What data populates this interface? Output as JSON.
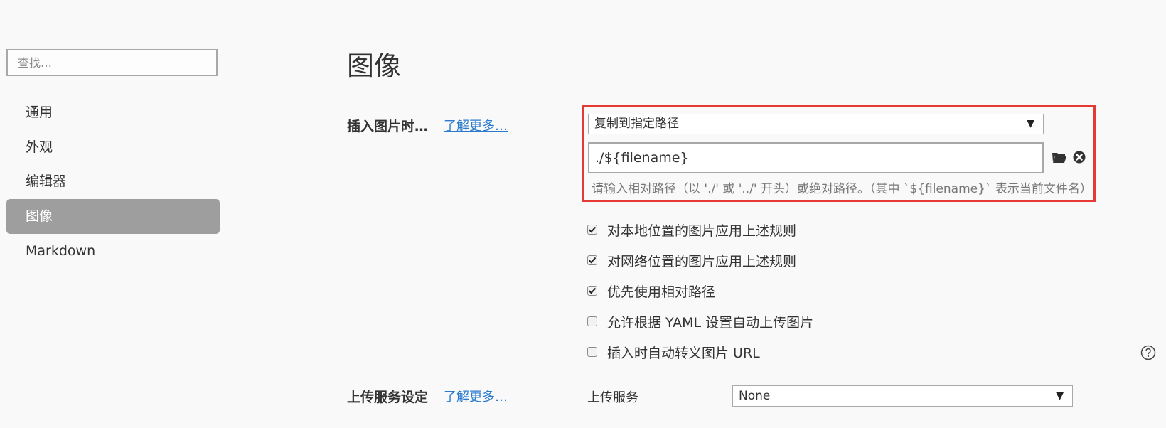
{
  "sidebar": {
    "search_placeholder": "查找…",
    "items": [
      {
        "label": "通用",
        "active": false
      },
      {
        "label": "外观",
        "active": false
      },
      {
        "label": "编辑器",
        "active": false
      },
      {
        "label": "图像",
        "active": true
      },
      {
        "label": "Markdown",
        "active": false
      }
    ]
  },
  "main": {
    "title": "图像",
    "insert_section": {
      "label": "插入图片时…",
      "learn_more": "了解更多…",
      "action_select": "复制到指定路径",
      "path_value": "./${filename}",
      "hint": "请输入相对路径（以 './' 或 '../' 开头）或绝对路径。（其中 `${filename}` 表示当前文件名）",
      "folder_icon": "folder-open-icon",
      "clear_icon": "clear-circle-icon",
      "highlight_color": "#e53935"
    },
    "options": [
      {
        "label": "对本地位置的图片应用上述规则",
        "checked": true
      },
      {
        "label": "对网络位置的图片应用上述规则",
        "checked": true
      },
      {
        "label": "优先使用相对路径",
        "checked": true
      },
      {
        "label": "允许根据 YAML 设置自动上传图片",
        "checked": false
      },
      {
        "label": "插入时自动转义图片 URL",
        "checked": false
      }
    ],
    "upload_section": {
      "label": "上传服务设定",
      "learn_more": "了解更多…",
      "service_label": "上传服务",
      "service_value": "None"
    },
    "help_icon": "help-circle-icon"
  },
  "colors": {
    "link": "#2a7bd0",
    "active_nav_bg": "#9e9e9e"
  }
}
